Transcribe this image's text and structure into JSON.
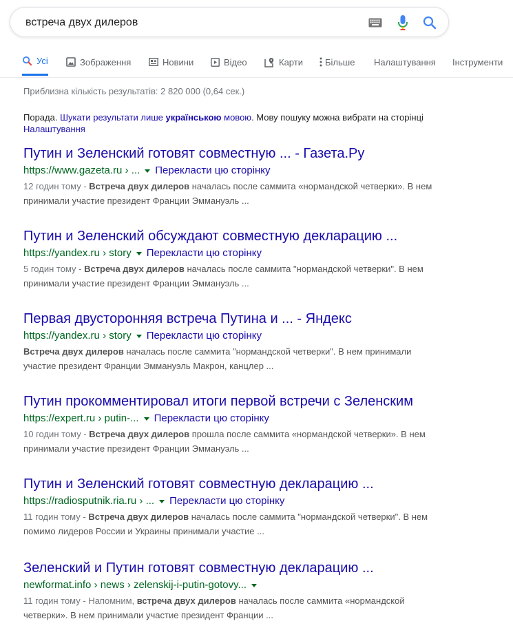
{
  "search": {
    "query": "встреча двух дилеров"
  },
  "icons": {
    "keyboard": "keyboard-icon",
    "mic": "mic-icon",
    "search": "search-icon"
  },
  "tabs": [
    {
      "label": "Усі",
      "icon": "search-icon",
      "active": true
    },
    {
      "label": "Зображення",
      "icon": "image-icon",
      "active": false
    },
    {
      "label": "Новини",
      "icon": "news-icon",
      "active": false
    },
    {
      "label": "Відео",
      "icon": "video-icon",
      "active": false
    },
    {
      "label": "Карти",
      "icon": "map-pin-icon",
      "active": false
    },
    {
      "label": "Більше",
      "icon": "more-vert-icon",
      "active": false
    },
    {
      "label": "Налаштування",
      "active": false
    },
    {
      "label": "Інструменти",
      "active": false
    }
  ],
  "stats": "Приблизна кількість результатів: 2 820 000 (0,64 сек.)",
  "tip": {
    "prefix": "Порада. ",
    "link1": "Шукати результати лише",
    "bold": "українською",
    "link2": "мовою",
    "middle": ". Мову пошуку можна вибрати на сторінці ",
    "settings_link": "Налаштування"
  },
  "translate_label": "Перекласти цю сторінку",
  "results": [
    {
      "title": "Путин и Зеленский готовят совместную ... - Газета.Ру",
      "url": "https://www.gazeta.ru › ...",
      "has_translate": true,
      "date": "12 годин тому - ",
      "bold": "Встреча двух дилеров",
      "rest": " началась после саммита «нормандской четверки». В нем принимали участие президент Франции Эммануэль ..."
    },
    {
      "title": "Путин и Зеленский обсуждают совместную декларацию ...",
      "url": "https://yandex.ru › story",
      "has_translate": true,
      "date": "5 годин тому - ",
      "bold": "Встреча двух дилеров",
      "rest": " началась после саммита \"нормандской четверки\". В нем принимали участие президент Франции Эммануэль ..."
    },
    {
      "title": "Первая двусторонняя встреча Путина и ... - Яндекс",
      "url": "https://yandex.ru › story",
      "has_translate": true,
      "date": "",
      "bold": "Встреча двух дилеров",
      "rest": " началась после саммита \"нормандской четверки\". В нем принимали участие президент Франции Эммануэль Макрон, канцлер ..."
    },
    {
      "title": "Путин прокомментировал итоги первой встречи с Зеленским",
      "url": "https://expert.ru › putin-...",
      "has_translate": true,
      "date": "10 годин тому - ",
      "bold": "Встреча двух дилеров",
      "rest": " прошла после саммита «нормандской четверки». В нем принимали участие президент Франции Эммануэль ..."
    },
    {
      "title": "Путин и Зеленский готовят совместную декларацию ...",
      "url": "https://radiosputnik.ria.ru › ...",
      "has_translate": true,
      "date": "11 годин тому - ",
      "bold": "Встреча двух дилеров",
      "rest": " началась после саммита \"нормандской четверки\". В нем помимо лидеров России и Украины принимали участие ..."
    },
    {
      "title": "Зеленский и Путин готовят совместную декларацию ...",
      "url": "newformat.info › news › zelenskij-i-putin-gotovy...",
      "has_translate": false,
      "date": "11 годин тому - Напомним, ",
      "bold": "встреча двух дилеров",
      "rest": " началась после саммита «нормандской четверки». В нем принимали участие президент Франции ..."
    }
  ]
}
